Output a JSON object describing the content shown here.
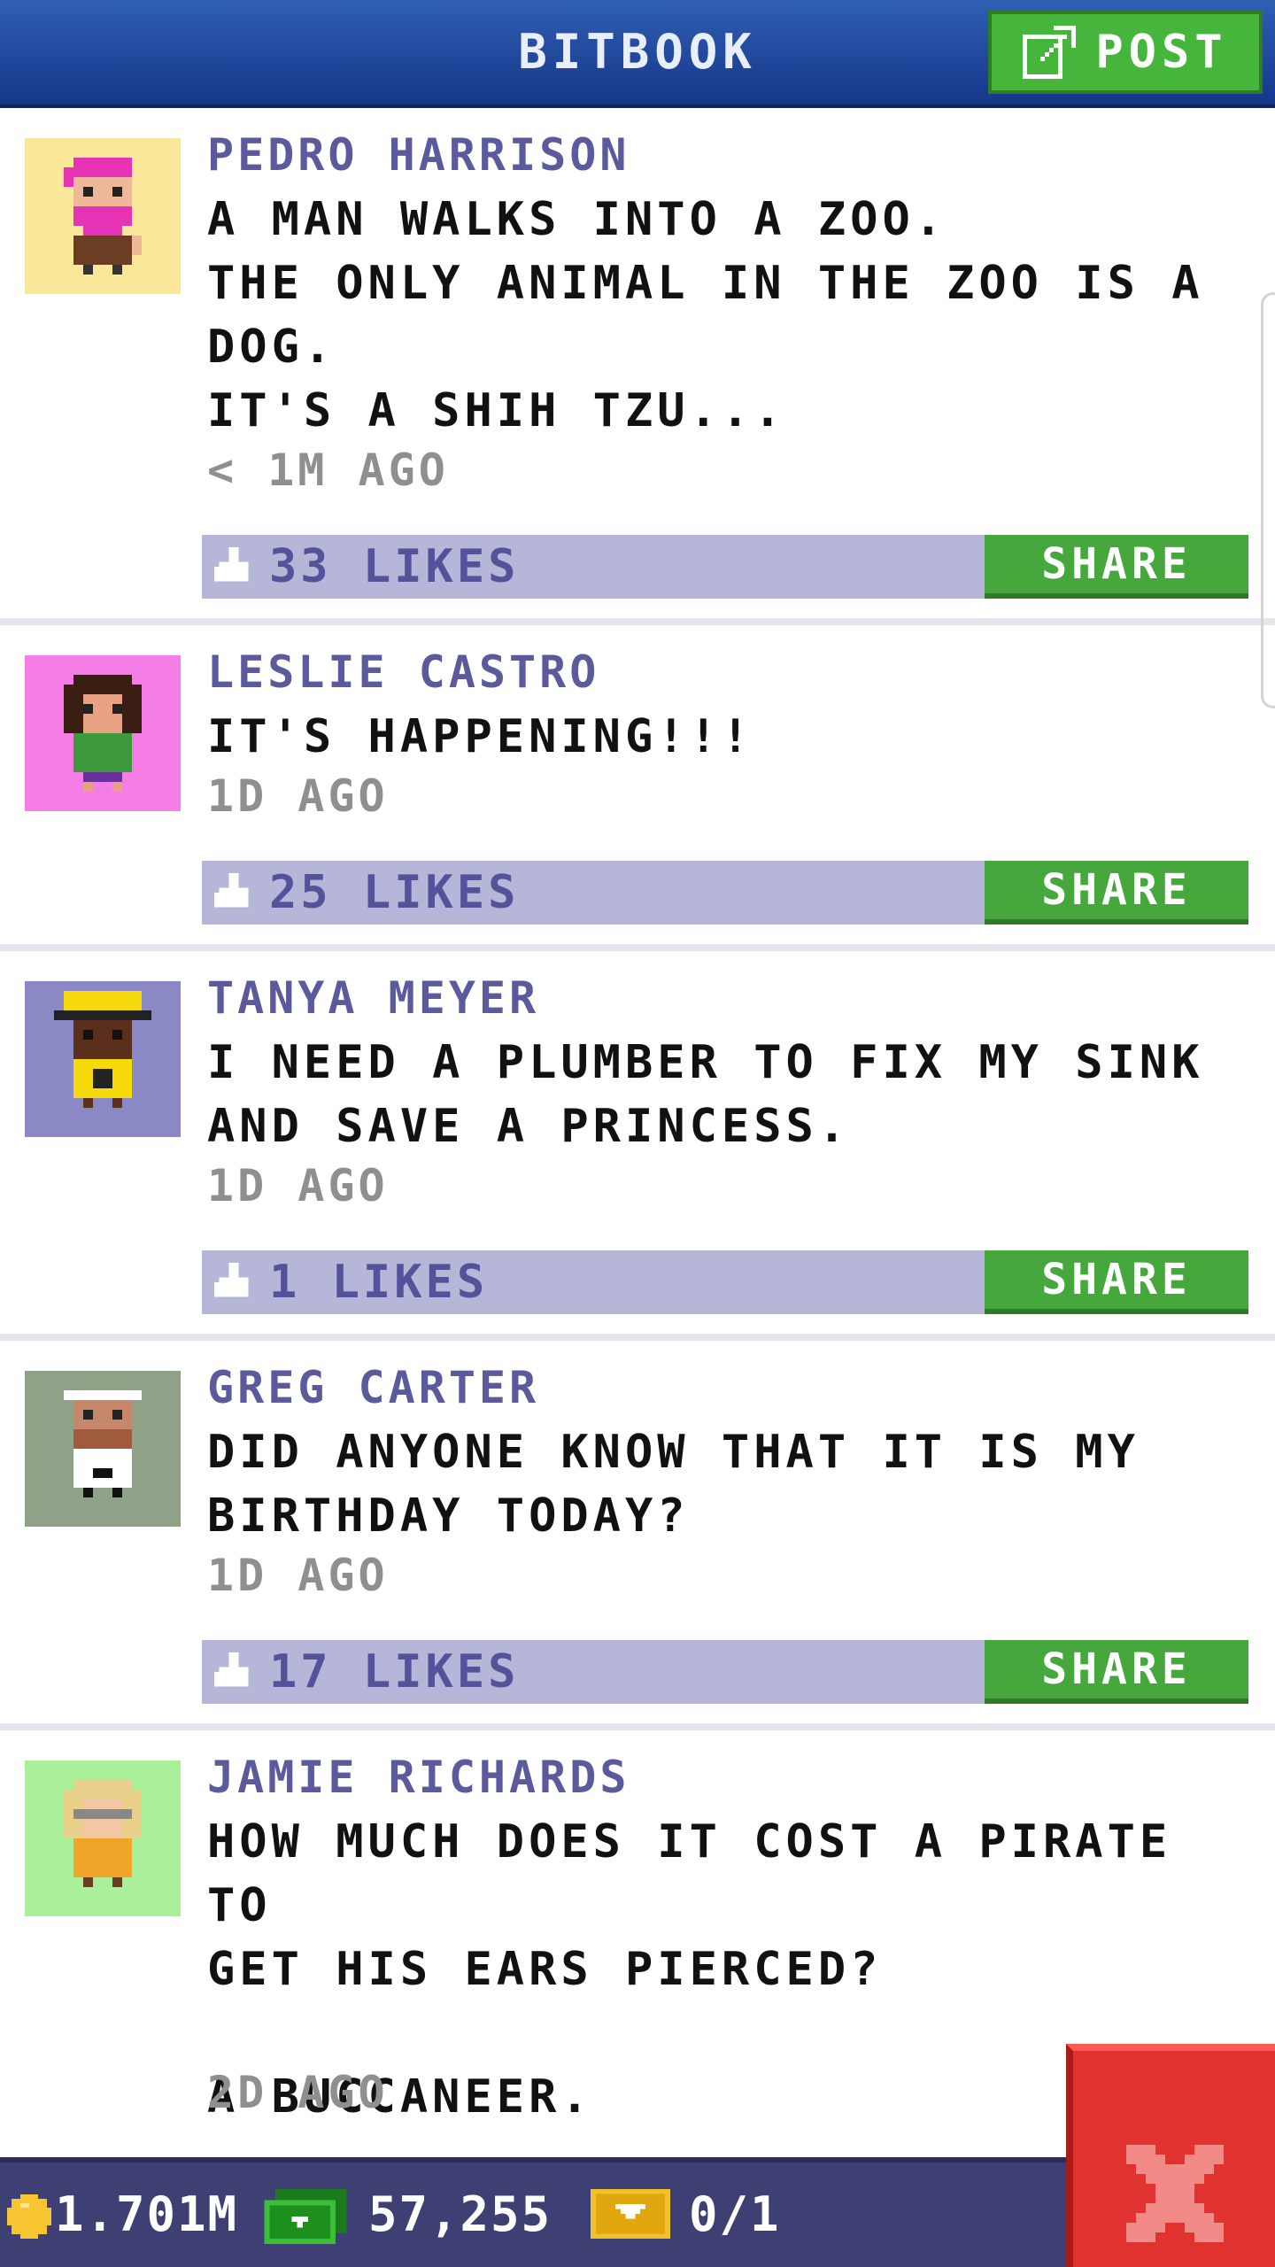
{
  "header": {
    "title": "BITBOOK",
    "post_label": "POST"
  },
  "posts": [
    {
      "name": "PEDRO HARRISON",
      "text": "A MAN WALKS INTO A ZOO.\nTHE ONLY ANIMAL IN THE ZOO IS A DOG.\nIT'S A SHIH TZU...",
      "time": "< 1M AGO",
      "likes": "33 LIKES",
      "share": "SHARE",
      "avatar_bg": "#fbe79a"
    },
    {
      "name": "LESLIE CASTRO",
      "text": "IT'S HAPPENING!!!",
      "time": "1D AGO",
      "likes": "25 LIKES",
      "share": "SHARE",
      "avatar_bg": "#f47ee6"
    },
    {
      "name": "TANYA MEYER",
      "text": "I NEED A PLUMBER TO FIX MY SINK\nAND SAVE A PRINCESS.",
      "time": "1D AGO",
      "likes": "1 LIKES",
      "share": "SHARE",
      "avatar_bg": "#8b88c6"
    },
    {
      "name": "GREG CARTER",
      "text": "DID ANYONE KNOW THAT IT IS MY\nBIRTHDAY TODAY?",
      "time": "1D AGO",
      "likes": "17 LIKES",
      "share": "SHARE",
      "avatar_bg": "#8fa287"
    },
    {
      "name": "JAMIE RICHARDS",
      "text": "HOW MUCH DOES IT COST A PIRATE TO\nGET HIS EARS PIERCED?\n\nA BUCCANEER.",
      "time": "2D AGO",
      "avatar_bg": "#aaf09a"
    }
  ],
  "stats": {
    "coins": "1.701M",
    "bux": "57,255",
    "tickets": "0/1"
  },
  "colors": {
    "header": "#1f4aa0",
    "share_green": "#46a83c",
    "likes_bar": "#b6b6d8",
    "name_purple": "#5b5a9c",
    "close_red": "#e0322f"
  },
  "icons": [
    "edit-icon",
    "like-icon",
    "coin-icon",
    "cash-icon",
    "ticket-icon",
    "close-icon"
  ]
}
